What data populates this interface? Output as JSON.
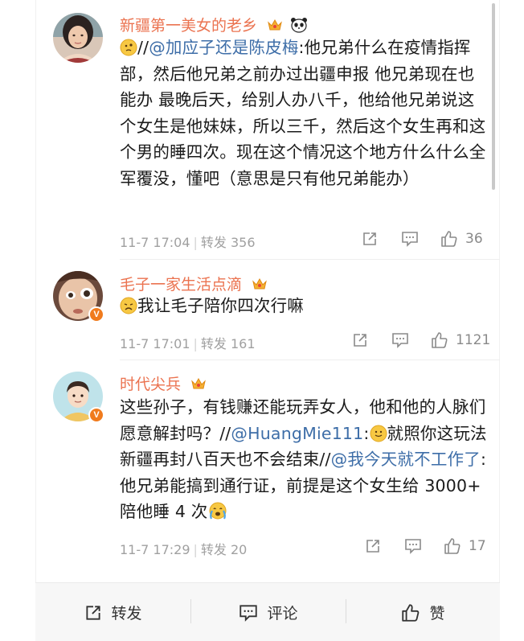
{
  "comments": [
    {
      "username": "新疆第一美女的老乡",
      "text_pre": "//",
      "mention1": "@加应子还是陈皮梅",
      "text_main": ":他兄弟什么在疫情指挥部，然后他兄弟之前办过出疆申报 他兄弟现在也能办 最晚后天，给别人办八千，他给他兄弟说这个女生是他妹妹，所以三千，然后这个女生再和这个男的睡四次。现在这个情况这个地方什么什么全军覆没，懂吧（意思是只有他兄弟能办）",
      "time": "11-7 17:04",
      "repost_label": "转发 356",
      "like_count": "36"
    },
    {
      "username": "毛子一家生活点滴",
      "text_main": "我让毛子陪你四次行嘛",
      "time": "11-7 17:01",
      "repost_label": "转发 161",
      "like_count": "1121"
    },
    {
      "username": "时代尖兵",
      "text_a": "这些孙子，有钱赚还能玩弄女人，他和他的人脉们愿意解封吗？//",
      "mention1": "@HuangMie111",
      "text_b": ":",
      "text_c": "就照你这玩法新疆再封八百天也不会结束//",
      "mention2": "@我今天就不工作了",
      "text_d": ":他兄弟能搞到通行证，前提是这个女生给 3000+ 陪他睡 4 次",
      "time": "11-7 17:29",
      "repost_label": "转发 20",
      "like_count": "17"
    }
  ],
  "bottom_bar": {
    "repost": "转发",
    "comment": "评论",
    "like": "赞"
  },
  "icons": {
    "verified_badge": "V",
    "accent_color": "#eb7350",
    "link_color": "#3e6ea8",
    "badge_color": "#f07b1d"
  }
}
